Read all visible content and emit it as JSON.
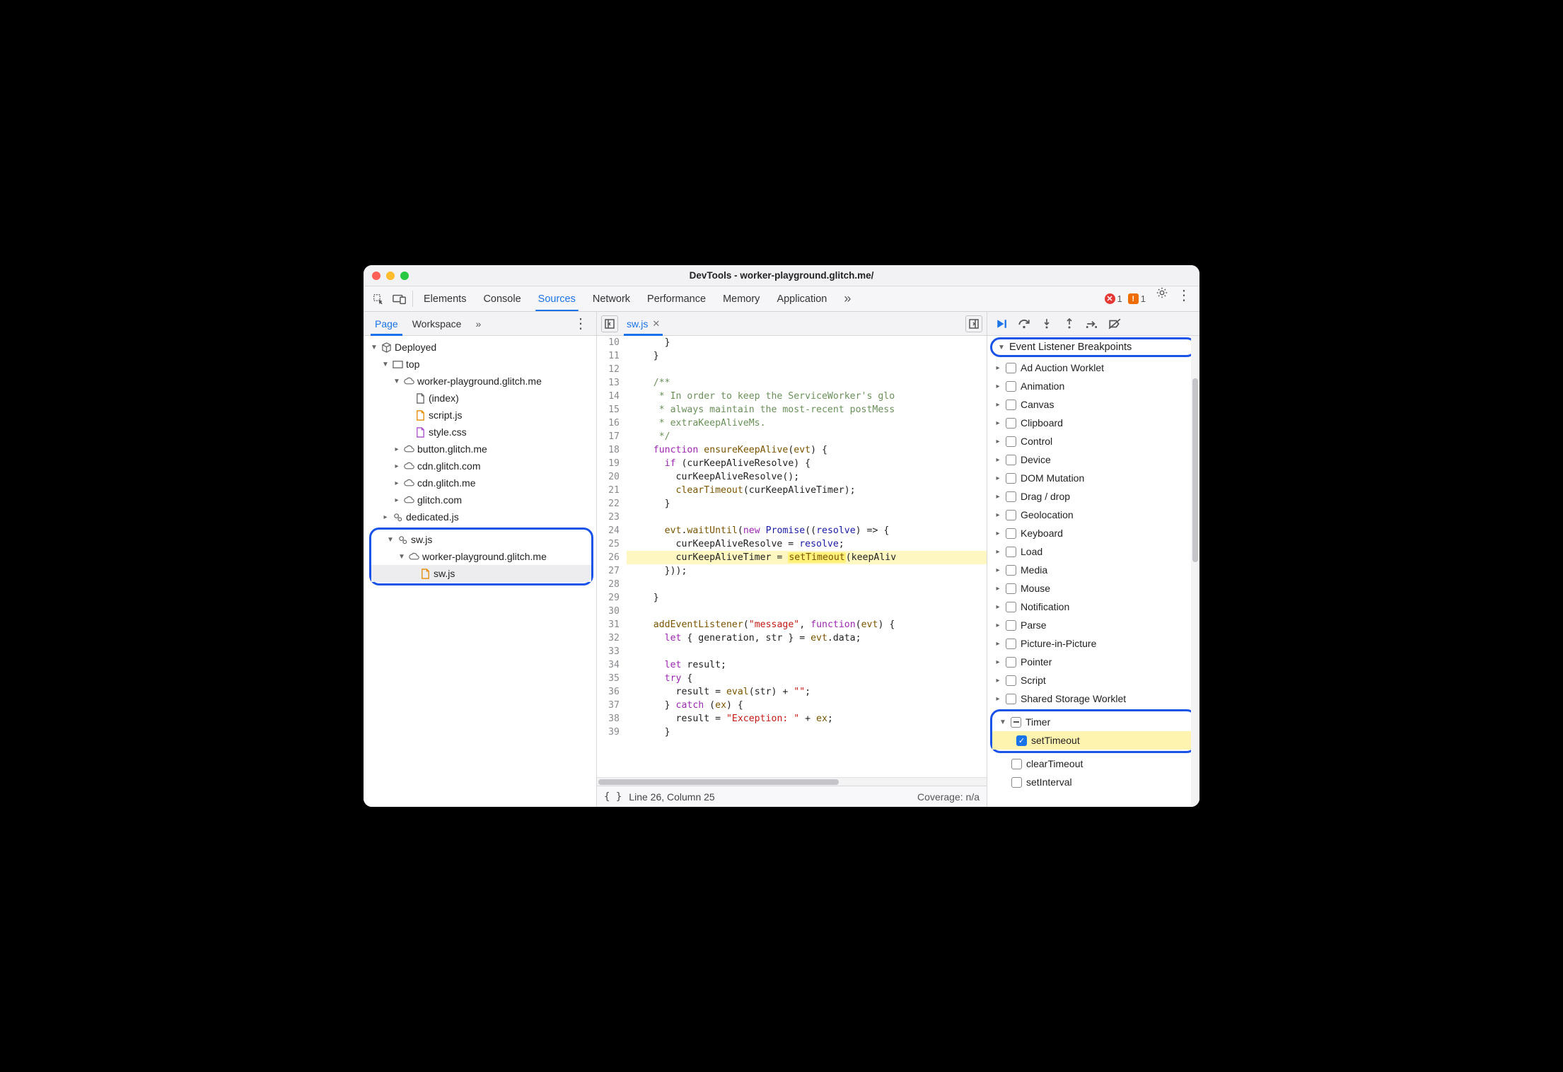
{
  "window_title": "DevTools - worker-playground.glitch.me/",
  "tabs": [
    "Elements",
    "Console",
    "Sources",
    "Network",
    "Performance",
    "Memory",
    "Application"
  ],
  "active_tab": "Sources",
  "errors": {
    "red": "1",
    "orange": "1"
  },
  "left": {
    "subtabs": [
      "Page",
      "Workspace"
    ],
    "active_subtab": "Page",
    "tree": {
      "deployed": "Deployed",
      "top": "top",
      "wp": "worker-playground.glitch.me",
      "index": "(index)",
      "scriptjs": "script.js",
      "stylecss": "style.css",
      "button": "button.glitch.me",
      "cdncom": "cdn.glitch.com",
      "cdnme": "cdn.glitch.me",
      "glitchcom": "glitch.com",
      "dedicated": "dedicated.js",
      "swroot": "sw.js",
      "sw_wp": "worker-playground.glitch.me",
      "swfile": "sw.js"
    }
  },
  "editor": {
    "tab_label": "sw.js",
    "first_line": 10,
    "lines": [
      "      }",
      "    }",
      "",
      "    /**",
      "     * In order to keep the ServiceWorker's glo",
      "     * always maintain the most-recent postMess",
      "     * extraKeepAliveMs.",
      "     */",
      "    function ensureKeepAlive(evt) {",
      "      if (curKeepAliveResolve) {",
      "        curKeepAliveResolve();",
      "        clearTimeout(curKeepAliveTimer);",
      "      }",
      "",
      "      evt.waitUntil(new Promise((resolve) => {",
      "        curKeepAliveResolve = resolve;",
      "        curKeepAliveTimer = setTimeout(keepAliv",
      "      }));",
      "",
      "    }",
      "",
      "    addEventListener(\"message\", function(evt) {",
      "      let { generation, str } = evt.data;",
      "",
      "      let result;",
      "      try {",
      "        result = eval(str) + \"\";",
      "      } catch (ex) {",
      "        result = \"Exception: \" + ex;",
      "      }"
    ],
    "status_line": "Line 26, Column 25",
    "coverage": "Coverage: n/a"
  },
  "right": {
    "section": "Event Listener Breakpoints",
    "categories": [
      "Ad Auction Worklet",
      "Animation",
      "Canvas",
      "Clipboard",
      "Control",
      "Device",
      "DOM Mutation",
      "Drag / drop",
      "Geolocation",
      "Keyboard",
      "Load",
      "Media",
      "Mouse",
      "Notification",
      "Parse",
      "Picture-in-Picture",
      "Pointer",
      "Script",
      "Shared Storage Worklet"
    ],
    "timer_label": "Timer",
    "timer_children": [
      "setTimeout",
      "clearTimeout",
      "setInterval"
    ],
    "timer_checked": "setTimeout"
  }
}
